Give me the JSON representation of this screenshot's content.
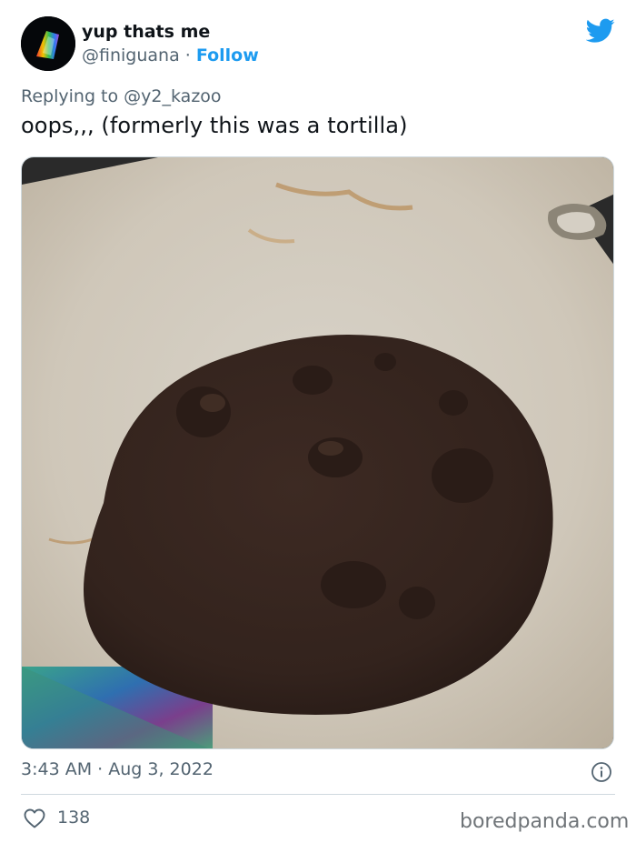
{
  "user": {
    "display_name": "yup thats me",
    "handle": "@finiguana",
    "separator": "·",
    "follow_label": "Follow"
  },
  "reply": {
    "prefix": "Replying to",
    "mention": "@y2_kazoo"
  },
  "tweet": {
    "text": "oops,,, (formerly this was a tortilla)",
    "time": "3:43 AM",
    "date_separator": "·",
    "date": "Aug 3, 2022"
  },
  "engagement": {
    "likes": "138"
  },
  "watermark": "boredpanda.com",
  "icons": {
    "brand": "twitter-bird-icon",
    "info": "info-icon",
    "like": "heart-icon"
  },
  "colors": {
    "accent": "#1d9bf0",
    "secondary_text": "#536471",
    "primary_text": "#0f1419",
    "divider": "#cfd9de"
  }
}
